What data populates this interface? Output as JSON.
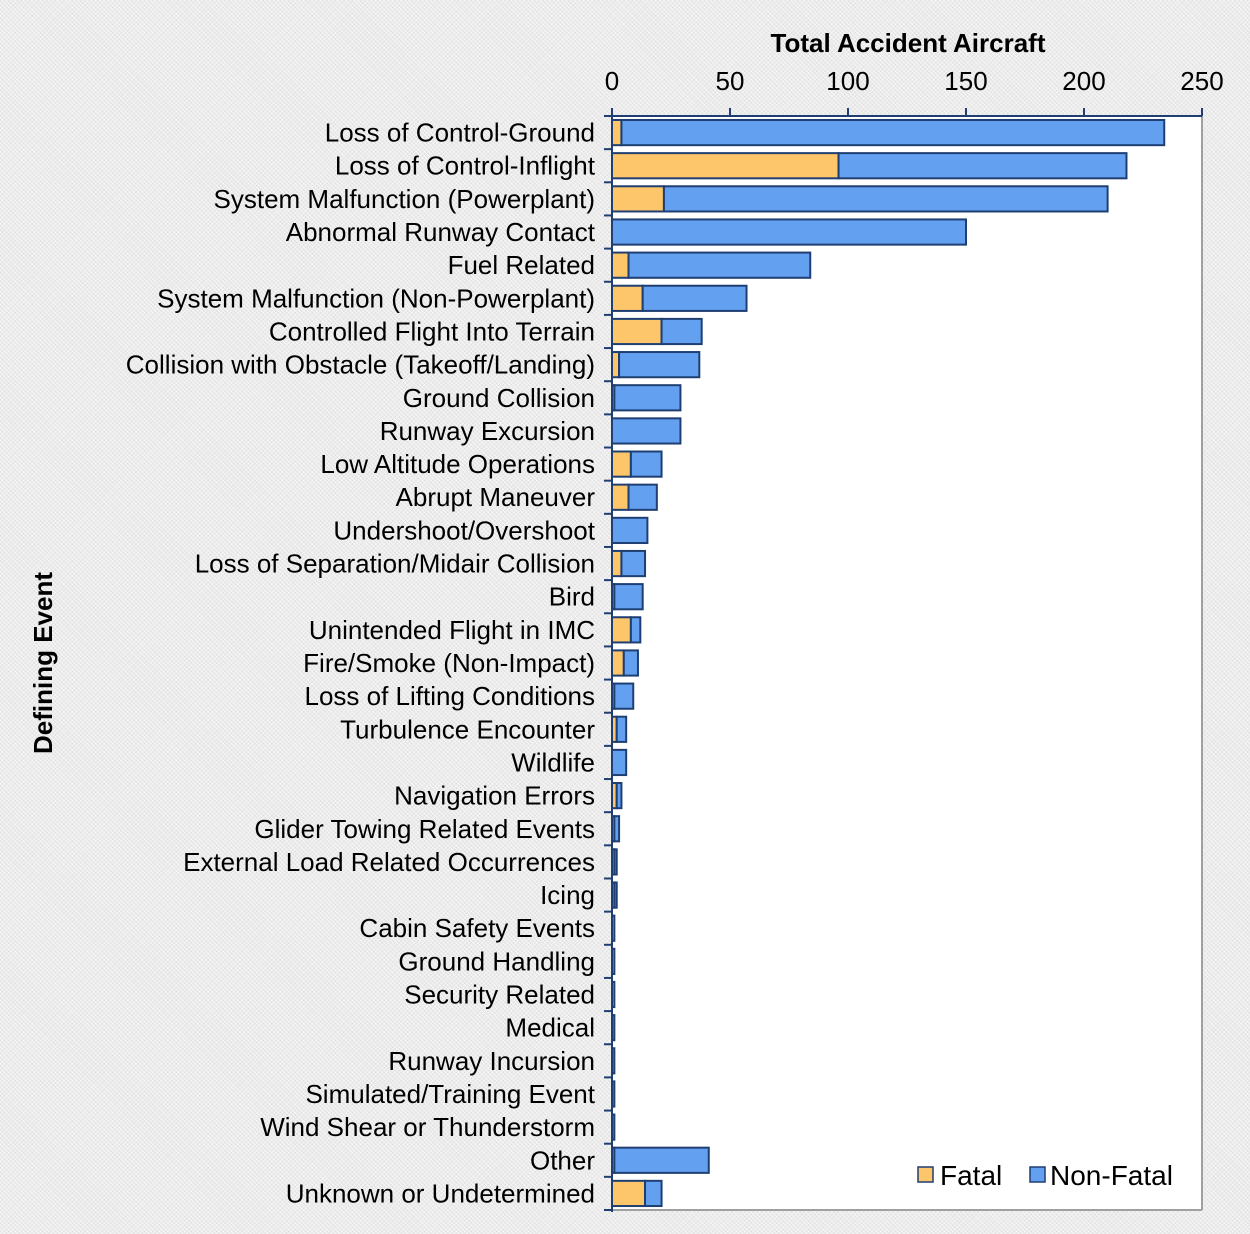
{
  "chart_data": {
    "type": "bar",
    "orientation": "horizontal",
    "stacked": true,
    "title": "",
    "xlabel": "Total Accident Aircraft",
    "ylabel": "Defining Event",
    "xlim": [
      0,
      250
    ],
    "xticks": [
      0,
      50,
      100,
      150,
      200,
      250
    ],
    "xtick_labels": [
      "0",
      "50",
      "100",
      "150",
      "200",
      "250"
    ],
    "x_axis_position": "top",
    "grid": false,
    "legend_position": "bottom-right",
    "categories": [
      "Loss of Control-Ground",
      "Loss of Control-Inflight",
      "System Malfunction (Powerplant)",
      "Abnormal Runway Contact",
      "Fuel Related",
      "System Malfunction (Non-Powerplant)",
      "Controlled Flight Into Terrain",
      "Collision with Obstacle (Takeoff/Landing)",
      "Ground Collision",
      "Runway Excursion",
      "Low Altitude Operations",
      "Abrupt Maneuver",
      "Undershoot/Overshoot",
      "Loss of Separation/Midair Collision",
      "Bird",
      "Unintended Flight in IMC",
      "Fire/Smoke (Non-Impact)",
      "Loss of Lifting Conditions",
      "Turbulence Encounter",
      "Wildlife",
      "Navigation Errors",
      "Glider Towing Related Events",
      "External Load Related Occurrences",
      "Icing",
      "Cabin Safety Events",
      "Ground Handling",
      "Security Related",
      "Medical",
      "Runway Incursion",
      "Simulated/Training Event",
      "Wind Shear or Thunderstorm",
      "Other",
      "Unknown or Undetermined"
    ],
    "series": [
      {
        "name": "Fatal",
        "color": "#FDC66A",
        "values": [
          4,
          96,
          22,
          0,
          7,
          13,
          21,
          3,
          1,
          0,
          8,
          7,
          0,
          4,
          1,
          8,
          5,
          1,
          2,
          0,
          2,
          1,
          1,
          1,
          1,
          1,
          1,
          0,
          0,
          0,
          0,
          1,
          14
        ]
      },
      {
        "name": "Non-Fatal",
        "color": "#63A0F0",
        "values": [
          230,
          122,
          188,
          150,
          77,
          44,
          17,
          34,
          28,
          29,
          13,
          12,
          15,
          10,
          12,
          4,
          6,
          8,
          4,
          6,
          2,
          2,
          1,
          1,
          0,
          0,
          0,
          1,
          1,
          1,
          1,
          40,
          7
        ]
      }
    ],
    "colors": {
      "bar_border": "#1F3F73",
      "axis": "#1F3F73",
      "plot_background": "#FFFFFF",
      "plot_frame": "#A0A0A0"
    }
  }
}
